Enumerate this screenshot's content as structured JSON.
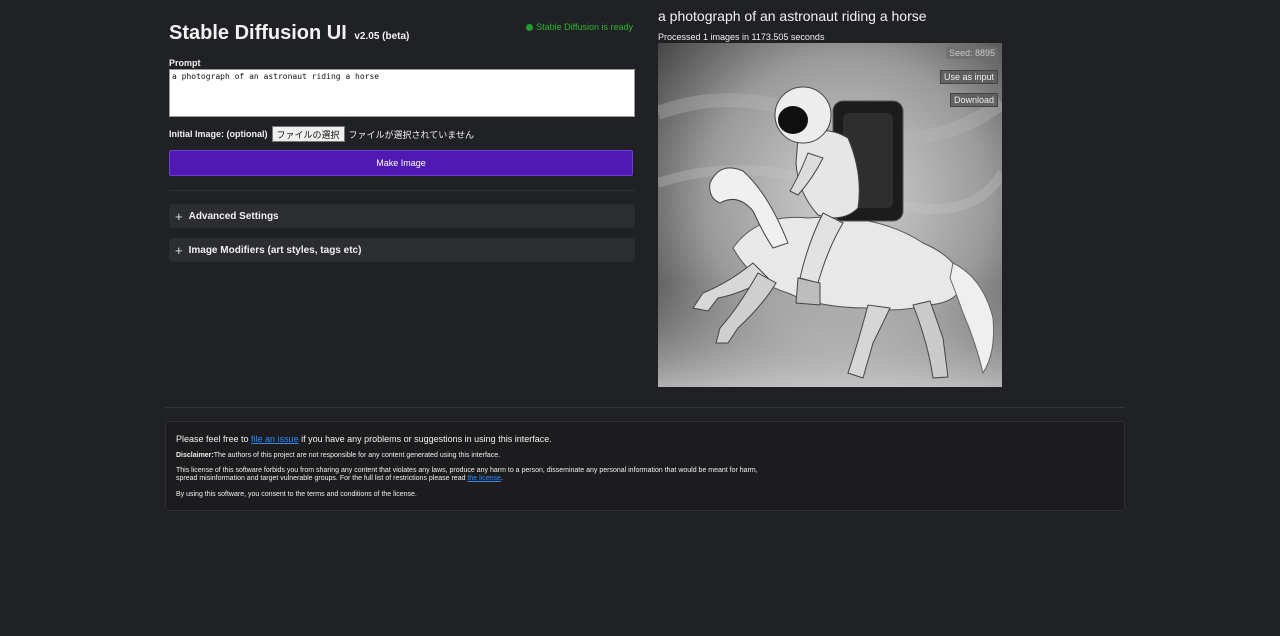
{
  "app": {
    "title": "Stable Diffusion UI",
    "version": "v2.05 (beta)",
    "status": "Stable Diffusion is ready"
  },
  "prompt": {
    "label": "Prompt",
    "value": "a photograph of an astronaut riding a horse"
  },
  "initial_image": {
    "label": "Initial Image: (optional)",
    "button_label": "ファイルの選択",
    "status_text": "ファイルが選択されていません"
  },
  "make_image_label": "Make Image",
  "panels": {
    "advanced": "Advanced Settings",
    "modifiers": "Image Modifiers (art styles, tags etc)"
  },
  "output": {
    "prompt": "a photograph of an astronaut riding a horse",
    "meta": "Processed 1 images in 1173.505 seconds",
    "seed": "Seed: 8895",
    "use_as_input": "Use as input",
    "download": "Download"
  },
  "footer": {
    "line1_before": "Please feel free to ",
    "line1_link": "file an issue",
    "line1_after": " if you have any problems or suggestions in using this interface.",
    "disclaimer_label": "Disclaimer:",
    "disclaimer_text": "The authors of this project are not responsible for any content generated using this interface.",
    "license_text": "This license of this software forbids you from sharing any content that violates any laws, produce any harm to a person, disseminate any personal information that would be meant for harm, spread misinformation and target vulnerable groups. For the full list of restrictions please read ",
    "license_link": "the license",
    "license_end": ".",
    "consent": "By using this software, you consent to the terms and conditions of the license."
  },
  "colors": {
    "background": "#202124",
    "accent": "#5019b2",
    "status_green": "#2db52d",
    "link": "#2b8cff"
  }
}
